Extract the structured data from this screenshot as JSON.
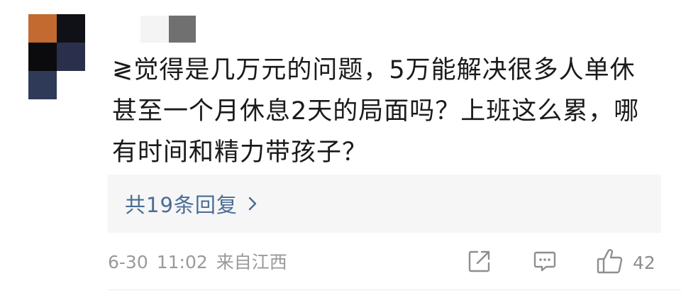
{
  "comment": {
    "lines": [
      "≷觉得是几万元的问题，5万能解决很多人单休",
      "甚至一个月休息2天的局面吗？上班这么累，哪",
      "有时间和精力带孩子？"
    ]
  },
  "replies": {
    "label": "共19条回复",
    "chevron_icon": "chevron-right-icon"
  },
  "footer": {
    "date": "6-30",
    "time": "11:02",
    "location": "来自江西",
    "share_icon": "share-icon",
    "comment_icon": "comment-icon",
    "like_icon": "thumbs-up-icon",
    "like_count": "42"
  },
  "colors": {
    "text": "#1a1a1a",
    "link": "#4a6c93",
    "meta": "#9a9a9a",
    "reply_bg": "#f6f6f7",
    "avatar_orange": "#c26a2f",
    "avatar_black": "#0d0d10",
    "avatar_navy": "#2a2f4c",
    "avatar_slate": "#2e3a58"
  }
}
